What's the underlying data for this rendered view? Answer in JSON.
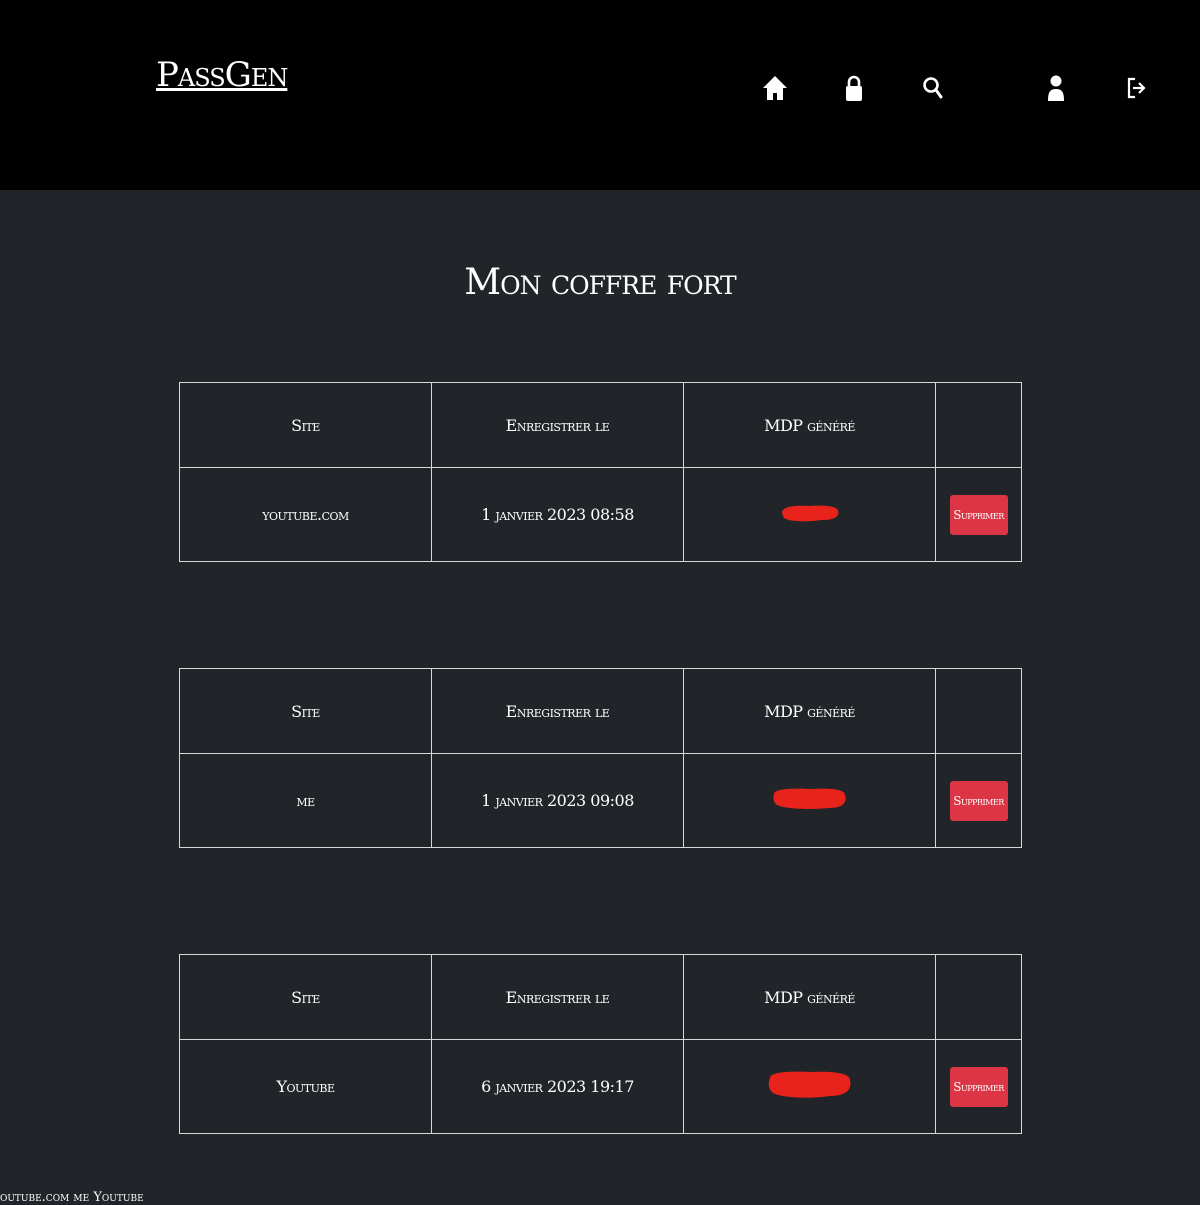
{
  "header": {
    "logo": "PassGen",
    "nav": [
      {
        "name": "home-icon"
      },
      {
        "name": "lock-icon"
      },
      {
        "name": "search-icon"
      },
      {
        "name": "user-icon"
      },
      {
        "name": "logout-icon"
      }
    ]
  },
  "page": {
    "title": "Mon coffre fort"
  },
  "columns": {
    "site": "Site",
    "date": "Enregistrer le",
    "password": "MDP généré",
    "action": ""
  },
  "entries": [
    {
      "site": "youtube.com",
      "date": "1 janvier 2023 08:58",
      "password": "",
      "delete_label": "Supprimer"
    },
    {
      "site": "me",
      "date": "1 janvier 2023 09:08",
      "password": "",
      "delete_label": "Supprimer"
    },
    {
      "site": "Youtube",
      "date": "6 janvier 2023 19:17",
      "password": "",
      "delete_label": "Supprimer"
    }
  ],
  "footer": {
    "text": "youtube.com me Youtube"
  },
  "colors": {
    "background": "#212428",
    "topbar": "#000000",
    "danger": "#dc3545",
    "redaction": "#e8231c"
  }
}
